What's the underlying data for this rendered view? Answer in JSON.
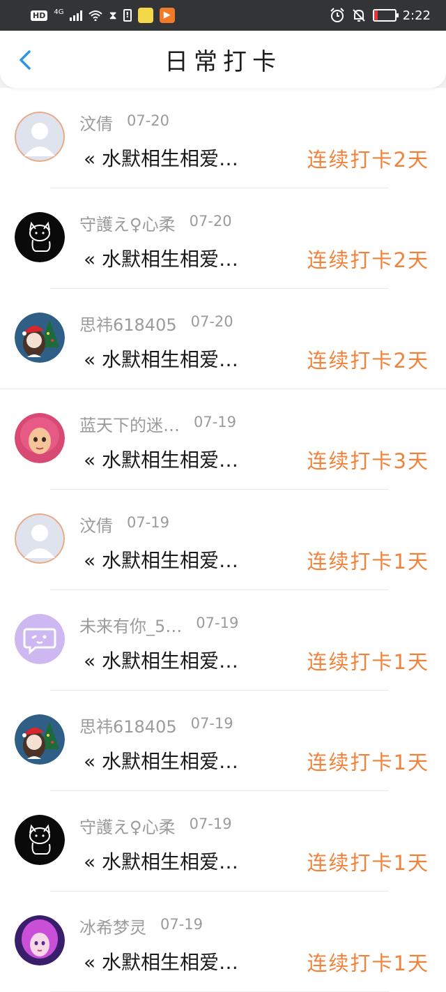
{
  "status_bar": {
    "hd": "HD",
    "network": "4G",
    "warn": "!",
    "app_icon": "▶",
    "time": "2:22",
    "battery_color": "#e8353a"
  },
  "header": {
    "title": "日常打卡",
    "back_icon": "chevron-left-icon",
    "accent": "#2b93e8"
  },
  "rows": [
    {
      "name": "汶倩",
      "date": "07-20",
      "message": "« 水默相生相爱…",
      "streak": "连续打卡2天",
      "avatar": "default-grey"
    },
    {
      "name": "守護え♀心柔",
      "date": "07-20",
      "message": "« 水默相生相爱…",
      "streak": "连续打卡2天",
      "avatar": "black-cat"
    },
    {
      "name": "思祎618405",
      "date": "07-20",
      "message": "« 水默相生相爱…",
      "streak": "连续打卡2天",
      "avatar": "christmas-girl"
    },
    {
      "name": "蓝天下的迷…",
      "date": "07-19",
      "message": "« 水默相生相爱…",
      "streak": "连续打卡3天",
      "avatar": "pink-hair-girl"
    },
    {
      "name": "汶倩",
      "date": "07-19",
      "message": "« 水默相生相爱…",
      "streak": "连续打卡1天",
      "avatar": "default-grey"
    },
    {
      "name": "未来有你_5…",
      "date": "07-19",
      "message": "« 水默相生相爱…",
      "streak": "连续打卡1天",
      "avatar": "purple-chat"
    },
    {
      "name": "思祎618405",
      "date": "07-19",
      "message": "« 水默相生相爱…",
      "streak": "连续打卡1天",
      "avatar": "christmas-girl"
    },
    {
      "name": "守護え♀心柔",
      "date": "07-19",
      "message": "« 水默相生相爱…",
      "streak": "连续打卡1天",
      "avatar": "black-cat"
    },
    {
      "name": "冰希梦灵",
      "date": "07-19",
      "message": "« 水默相生相爱…",
      "streak": "连续打卡1天",
      "avatar": "purple-anime-girl"
    }
  ],
  "colors": {
    "streak": "#f0823a",
    "name": "#9b9b9b",
    "status_bar_bg": "#333436"
  }
}
